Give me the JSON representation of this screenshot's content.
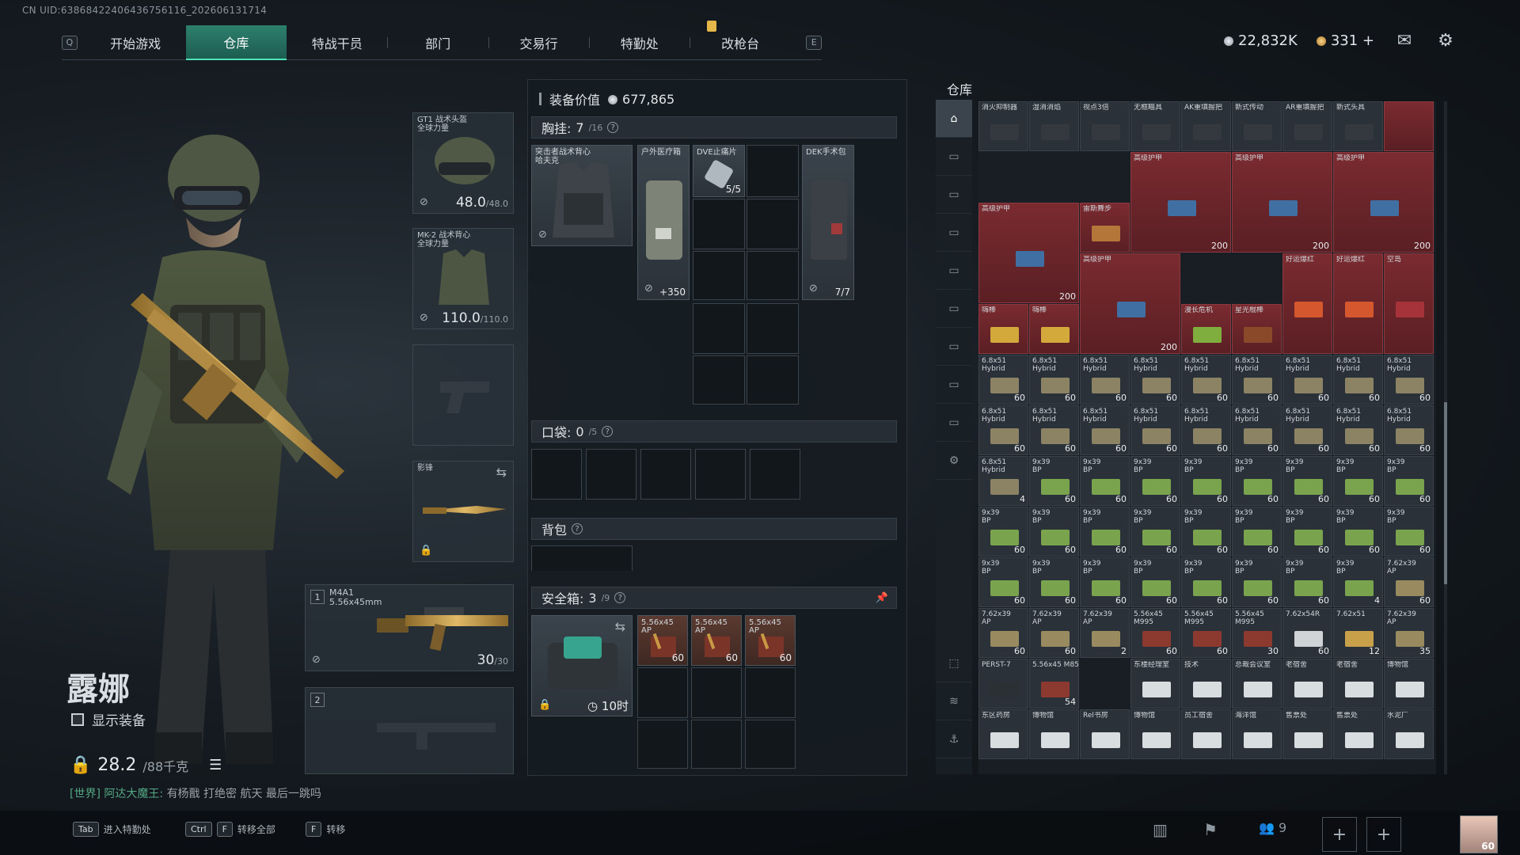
{
  "uid": "CN UID:6386842240643675611​6_202606131714",
  "nav": {
    "left_key": "Q",
    "right_key": "E",
    "tabs": [
      {
        "label": "开始游戏"
      },
      {
        "label": "仓库"
      },
      {
        "label": "特战干员"
      },
      {
        "label": "部门"
      },
      {
        "label": "交易行"
      },
      {
        "label": "特勤处"
      },
      {
        "label": "改枪台"
      }
    ],
    "active_tab": "仓库"
  },
  "currency": {
    "silver": "22,832K",
    "gold": "331",
    "add": "+"
  },
  "character": {
    "name": "露娜",
    "show_gear_label": "显示装备",
    "weight": "28.2",
    "weight_max": "/88千克",
    "chat_channel": "[世界]",
    "chat_user": "阿达大魔王:",
    "chat_msg": "有杨戬 打绝密 航天 最后一跳吗"
  },
  "equip": {
    "helmet": {
      "name": "GT1 战术头盔",
      "sub": "全球力量",
      "durability": "48.0",
      "max": "/48.0"
    },
    "armor": {
      "name": "MK-2 战术背心",
      "sub": "全球力量",
      "durability": "110.0",
      "max": "/110.0"
    },
    "melee": {
      "name": "影锋"
    },
    "primary": {
      "slot": "1",
      "name": "M4A1",
      "caliber": "5.56x45mm",
      "ammo": "30",
      "ammo_max": "/30"
    },
    "secondary": {
      "slot": "2"
    }
  },
  "loadout": {
    "value_label": "装备价值",
    "value": "677,865",
    "chest_label": "胸挂:",
    "chest_count": "7",
    "chest_max": "/16",
    "chest_rig_name": "突击者战术背心",
    "chest_rig_sub": "哈夫克",
    "medkit_name": "户外医疗箱",
    "medkit_value": "+350",
    "dve_name": "DVE止痛片",
    "dve_count": "5/5",
    "dek_name": "DEK手术包",
    "dek_count": "7/7",
    "pocket_label": "口袋:",
    "pocket_count": "0",
    "pocket_max": "/5",
    "backpack_label": "背包",
    "safe_label": "安全箱:",
    "safe_count": "3",
    "safe_max": "/9",
    "safe_timer": "10时",
    "safe_ammo": [
      {
        "name": "5.56x45",
        "sub": "AP",
        "count": "60"
      },
      {
        "name": "5.56x45",
        "sub": "AP",
        "count": "60"
      },
      {
        "name": "5.56x45",
        "sub": "AP",
        "count": "60"
      }
    ]
  },
  "warehouse": {
    "title": "仓库",
    "top_row": [
      "消火抑制器",
      "湿消消焰",
      "视点3倍",
      "无框瞄具",
      "AK重填握把",
      "新式传动",
      "AR重填握把",
      "新式头具",
      "雷斯舞步"
    ],
    "armor_label": "高级护甲",
    "armor_value": "200",
    "drink_label": "雷斯舞步",
    "row4": [
      "嗨棒",
      "嗨棒",
      "",
      "",
      "漫长危机",
      "星光棍棒",
      "好运爆红",
      "好运爆红",
      "空岛"
    ],
    "ammo_68": "6.8x51",
    "ammo_68_sub": "Hybrid",
    "ammo_939": "9x39",
    "ammo_939_sub": "BP",
    "ammo_762": "7.62x39",
    "ammo_762_sub": "AP",
    "ammo_556": "5.56x45",
    "ammo_556_sub": "M995",
    "ammo_762x54": "7.62x54R",
    "ammo_762x51": "7.62x51",
    "count_60": "60",
    "count_4": "4",
    "count_2": "2",
    "count_30": "30",
    "count_12": "12",
    "count_35": "35",
    "count_54": "54",
    "row10": [
      "PERST-7",
      "5.56x45 M855A1",
      "",
      "东楼经理室",
      "技术",
      "总裁会议室",
      "老宿舍",
      "老宿舍",
      "博物馆"
    ],
    "row11": [
      "东区药房",
      "博物馆",
      "Rel书房",
      "博物馆",
      "员工宿舍",
      "海洋馆",
      "售票处",
      "售票处",
      "水泥厂"
    ]
  },
  "bottom": {
    "tab_key": "Tab",
    "tab_label": "进入特勤处",
    "ctrl_key": "Ctrl",
    "f_key": "F",
    "transfer_all": "转移全部",
    "transfer": "转移",
    "friends": "9",
    "avatar_level": "60"
  }
}
